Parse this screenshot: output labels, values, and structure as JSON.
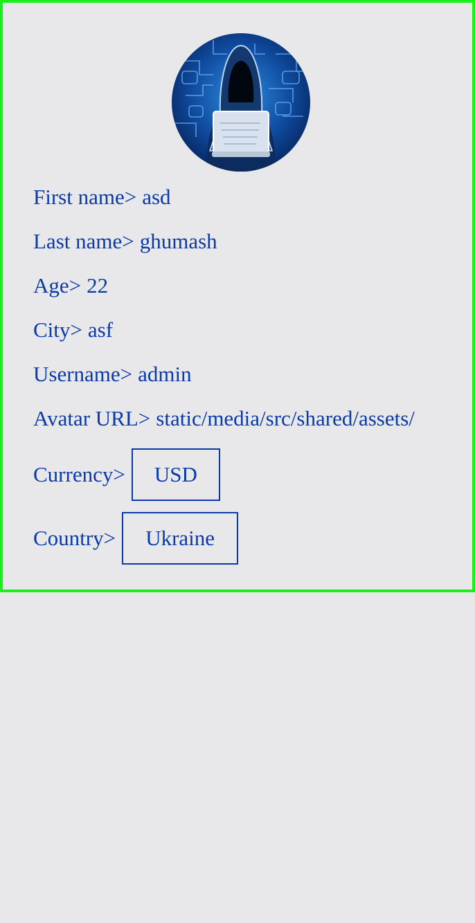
{
  "profile": {
    "avatar_icon": "hacker-laptop-avatar",
    "fields": {
      "first_name": {
        "label": "First name>",
        "value": "asd"
      },
      "last_name": {
        "label": "Last name>",
        "value": "ghumash"
      },
      "age": {
        "label": "Age>",
        "value": "22"
      },
      "city": {
        "label": "City>",
        "value": "asf"
      },
      "username": {
        "label": "Username>",
        "value": "admin"
      },
      "avatar_url": {
        "label": "Avatar URL>",
        "value": "static/media/src/shared/assets/"
      }
    },
    "currency": {
      "label": "Currency>",
      "selected": "USD"
    },
    "country": {
      "label": "Country>",
      "selected": "Ukraine"
    }
  },
  "colors": {
    "text": "#0a3aa8",
    "border_accent": "#19f019",
    "background": "#e8e7ea"
  }
}
